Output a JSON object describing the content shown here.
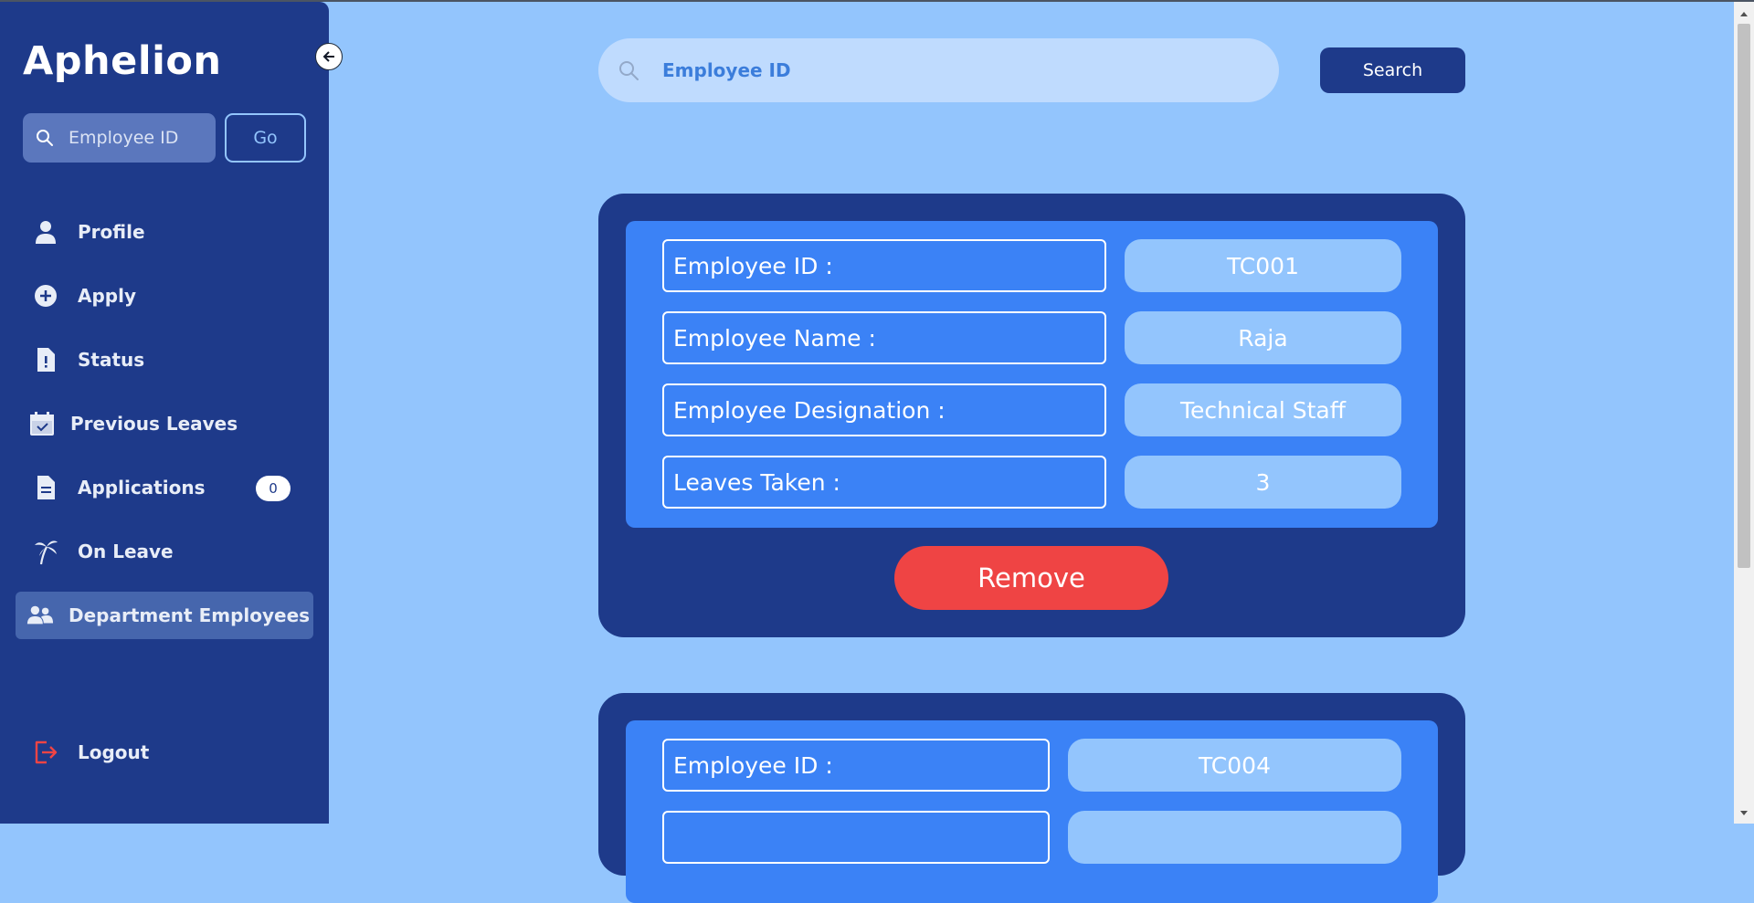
{
  "sidebar": {
    "brand": "Aphelion",
    "search_placeholder": "Employee ID",
    "go_label": "Go",
    "items": [
      {
        "label": "Profile",
        "icon": "user-icon"
      },
      {
        "label": "Apply",
        "icon": "plus-circle-icon"
      },
      {
        "label": "Status",
        "icon": "file-exclamation-icon"
      },
      {
        "label": "Previous Leaves",
        "icon": "calendar-check-icon"
      },
      {
        "label": "Applications",
        "icon": "document-icon",
        "badge": "0"
      },
      {
        "label": "On Leave",
        "icon": "palm-tree-icon"
      },
      {
        "label": "Department Employees",
        "icon": "users-icon",
        "active": true
      }
    ],
    "logout_label": "Logout"
  },
  "main": {
    "search_placeholder": "Employee ID",
    "search_label": "Search",
    "cards": [
      {
        "fields": [
          {
            "label": "Employee ID :",
            "value": "TC001"
          },
          {
            "label": "Employee Name :",
            "value": "Raja"
          },
          {
            "label": "Employee Designation :",
            "value": "Technical Staff"
          },
          {
            "label": "Leaves Taken :",
            "value": "3"
          }
        ],
        "remove_label": "Remove"
      },
      {
        "fields": [
          {
            "label": "Employee ID :",
            "value": "TC004"
          }
        ]
      }
    ]
  },
  "colors": {
    "sidebar_bg": "#1e3a8a",
    "page_bg": "#93c5fd",
    "card_inner": "#3b82f6",
    "remove": "#ef4444",
    "logout_icon": "#ef4444"
  }
}
